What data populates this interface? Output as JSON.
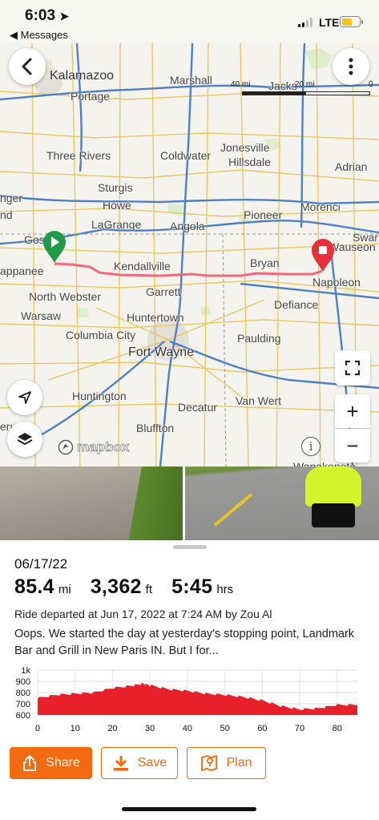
{
  "status_bar": {
    "time": "6:03",
    "back_app": "◀ Messages",
    "network": "LTE"
  },
  "map": {
    "scale": {
      "left": "40 mi",
      "mid": "20 mi",
      "right": "0"
    },
    "attribution": "mapbox",
    "towns": {
      "kalamazoo": "Kalamazoo",
      "marshall": "Marshall",
      "jackson": "Jacks",
      "portage": "Portage",
      "three_rivers": "Three Rivers",
      "coldwater": "Coldwater",
      "jonesville": "Jonesville",
      "hillsdale": "Hillsdale",
      "adrian": "Adrian",
      "sturgis": "Sturgis",
      "howe": "Howe",
      "lagrange": "LaGrange",
      "angola": "Angola",
      "pioneer": "Pioneer",
      "morenci": "Morenci",
      "swan": "Swar",
      "elkhart_partial": "nger",
      "nd_partial": "nd",
      "goshen_partial": "Gos",
      "wauseon": "Wauseon",
      "nappanee": "appanee",
      "kendallville": "Kendallville",
      "bryan": "Bryan",
      "napoleon": "Napoleon",
      "north_webster": "North Webster",
      "garrett": "Garrett",
      "defiance": "Defiance",
      "warsaw": "Warsaw",
      "huntertown": "Huntertown",
      "columbia_city": "Columbia City",
      "paulding": "Paulding",
      "fort_wayne": "Fort Wayne",
      "huntington": "Huntington",
      "van_wert": "Van Wert",
      "decatur": "Decatur",
      "bluffton": "Bluffton",
      "peru_partial": "eru",
      "wapakoneta_partial": "Wapakoneta"
    },
    "icons": {
      "back": "chevron-left-icon",
      "more": "more-vertical-icon",
      "locate": "navigation-arrow-icon",
      "layers": "layers-icon",
      "fullscreen": "fullscreen-icon",
      "zoom_in": "plus-icon",
      "zoom_out": "minus-icon",
      "start": "start-marker-icon",
      "end": "end-marker-icon"
    },
    "route_color": "#f26a7a",
    "start_color": "#1f9a4a",
    "end_color": "#e8303a"
  },
  "ride": {
    "date": "06/17/22",
    "distance_value": "85.4",
    "distance_unit": "mi",
    "elevation_value": "3,362",
    "elevation_unit": "ft",
    "duration_value": "5:45",
    "duration_unit": "hrs",
    "departed": "Ride departed at Jun 17, 2022 at 7:24 AM by Zou Al",
    "description": "Oops.  We started the day at yesterday's stopping point, Landmark Bar and Grill in New Paris IN.  But I for..."
  },
  "chart_data": {
    "type": "area",
    "xlabel": "",
    "ylabel": "",
    "x_ticks": [
      "0",
      "10",
      "20",
      "30",
      "40",
      "50",
      "60",
      "70",
      "80"
    ],
    "y_ticks": [
      "1k",
      "900",
      "800",
      "700",
      "600"
    ],
    "xlim": [
      0,
      85.4
    ],
    "ylim": [
      600,
      1000
    ],
    "color": "#e8202a",
    "x": [
      0,
      5,
      10,
      15,
      20,
      25,
      28,
      30,
      35,
      40,
      45,
      50,
      55,
      60,
      65,
      70,
      75,
      80,
      85.4
    ],
    "values": [
      750,
      780,
      790,
      800,
      840,
      860,
      880,
      865,
      830,
      815,
      790,
      780,
      760,
      730,
      680,
      650,
      660,
      690,
      690
    ]
  },
  "actions": {
    "share": "Share",
    "save": "Save",
    "plan": "Plan"
  }
}
